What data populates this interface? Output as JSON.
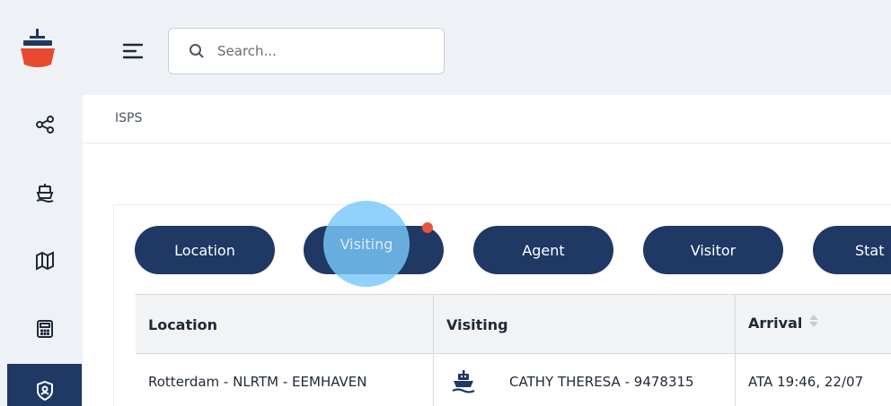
{
  "search": {
    "placeholder": "Search..."
  },
  "breadcrumb": {
    "label": "ISPS"
  },
  "filters": [
    {
      "label": "Location"
    },
    {
      "label": "Visiting"
    },
    {
      "label": "Agent"
    },
    {
      "label": "Visitor"
    },
    {
      "label": "Stat"
    }
  ],
  "table": {
    "headers": [
      "Location",
      "Visiting",
      "Arrival"
    ],
    "rows": [
      {
        "location": "Rotterdam - NLRTM - EEMHAVEN",
        "visiting": "CATHY THERESA - 9478315",
        "arrival": "ATA 19:46, 22/07"
      }
    ]
  },
  "colors": {
    "primary": "#1f3864",
    "accent": "#e8553f",
    "ripple": "#78c8fa",
    "background": "#eef2f6"
  },
  "icons": {
    "logo": "ship-logo-icon",
    "nav": [
      "share-nodes-icon",
      "ship-icon",
      "map-icon",
      "calculator-icon",
      "shield-user-icon"
    ],
    "menu": "hamburger-menu-icon",
    "search": "search-icon",
    "sort": "sort-icon",
    "row_ship": "ship-icon"
  }
}
